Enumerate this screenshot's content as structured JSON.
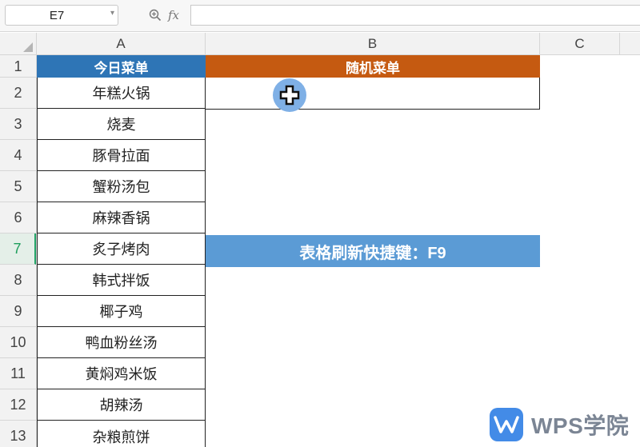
{
  "formula_bar": {
    "name_box": "E7",
    "fx_label": "fx",
    "formula": ""
  },
  "columns": [
    "A",
    "B",
    "C"
  ],
  "rows": [
    "1",
    "2",
    "3",
    "4",
    "5",
    "6",
    "7",
    "8",
    "9",
    "10",
    "11",
    "12",
    "13"
  ],
  "sheet": {
    "header_a": "今日菜单",
    "header_b": "随机菜单",
    "b2_value": "",
    "menu_items": [
      "年糕火锅",
      "烧麦",
      "豚骨拉面",
      "蟹粉汤包",
      "麻辣香锅",
      "炙子烤肉",
      "韩式拌饭",
      "椰子鸡",
      "鸭血粉丝汤",
      "黄焖鸡米饭",
      "胡辣汤",
      "杂粮煎饼"
    ],
    "tip_text": "表格刷新快捷键：F9"
  },
  "colors": {
    "header_a_bg": "#2e75b6",
    "header_b_bg": "#c55a11",
    "tip_bg": "#5b9bd5",
    "active_row": "#21a366"
  },
  "icons": {
    "zoom": "zoom-icon",
    "cursor": "cell-select-cursor-icon",
    "logo": "wps-logo-icon"
  },
  "watermark": {
    "text": "WPS学院"
  }
}
